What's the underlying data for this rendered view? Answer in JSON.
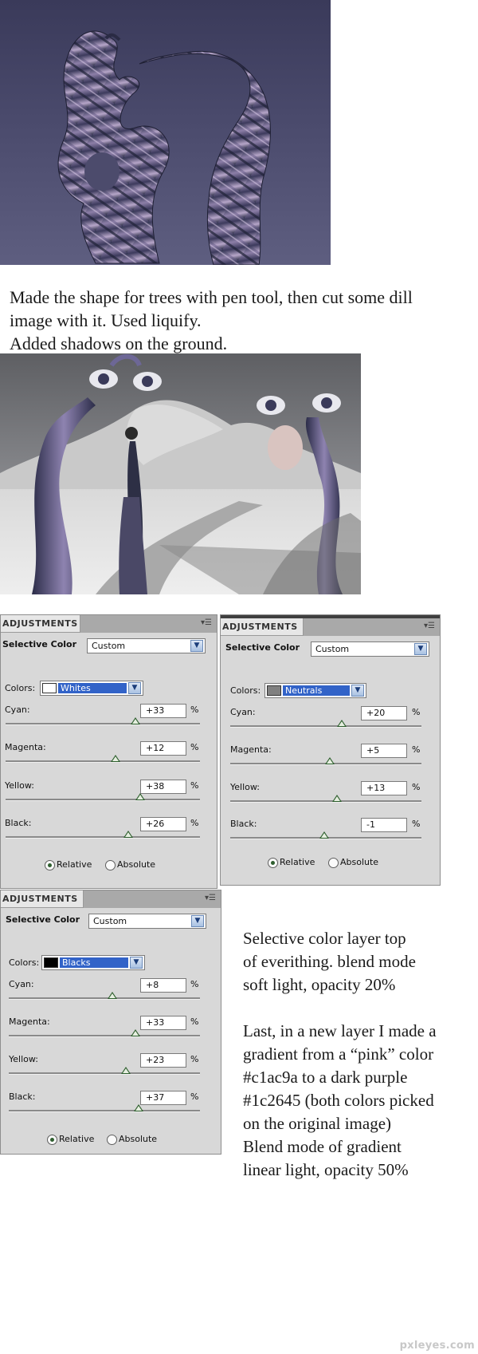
{
  "caption_top": [
    "Made the shape for trees with pen tool, then cut some dill",
    "image with it. Used liquify.",
    "Added shadows on the ground."
  ],
  "panels": [
    {
      "tab": "ADJUSTMENTS",
      "title": "Selective Color",
      "preset": "Custom",
      "colors_label": "Colors:",
      "color": "Whites",
      "swatch_color": "#ffffff",
      "sliders": [
        {
          "label": "Cyan:",
          "value": "+33",
          "pct": "%",
          "level": 33
        },
        {
          "label": "Magenta:",
          "value": "+12",
          "pct": "%",
          "level": 12
        },
        {
          "label": "Yellow:",
          "value": "+38",
          "pct": "%",
          "level": 38
        },
        {
          "label": "Black:",
          "value": "+26",
          "pct": "%",
          "level": 26
        }
      ],
      "relative": "Relative",
      "absolute": "Absolute",
      "mode": "relative"
    },
    {
      "tab": "ADJUSTMENTS",
      "title": "Selective Color",
      "preset": "Custom",
      "colors_label": "Colors:",
      "color": "Neutrals",
      "swatch_color": "#808080",
      "sliders": [
        {
          "label": "Cyan:",
          "value": "+20",
          "pct": "%",
          "level": 20
        },
        {
          "label": "Magenta:",
          "value": "+5",
          "pct": "%",
          "level": 5
        },
        {
          "label": "Yellow:",
          "value": "+13",
          "pct": "%",
          "level": 13
        },
        {
          "label": "Black:",
          "value": "-1",
          "pct": "%",
          "level": -1
        }
      ],
      "relative": "Relative",
      "absolute": "Absolute",
      "mode": "relative"
    },
    {
      "tab": "ADJUSTMENTS",
      "title": "Selective Color",
      "preset": "Custom",
      "colors_label": "Colors:",
      "color": "Blacks",
      "swatch_color": "#000000",
      "sliders": [
        {
          "label": "Cyan:",
          "value": "+8",
          "pct": "%",
          "level": 8
        },
        {
          "label": "Magenta:",
          "value": "+33",
          "pct": "%",
          "level": 33
        },
        {
          "label": "Yellow:",
          "value": "+23",
          "pct": "%",
          "level": 23
        },
        {
          "label": "Black:",
          "value": "+37",
          "pct": "%",
          "level": 37
        }
      ],
      "relative": "Relative",
      "absolute": "Absolute",
      "mode": "relative"
    }
  ],
  "caption_bottom": [
    "Selective color layer top",
    "of everithing. blend mode",
    "soft light, opacity 20%",
    "",
    "Last, in a new layer I made a",
    "gradient from a “pink” color",
    "#c1ac9a to a dark purple",
    "#1c2645 (both colors picked",
    "on the original image)",
    "Blend mode of gradient",
    "linear light, opacity 50%"
  ],
  "watermark": "pxleyes.com",
  "colors": {
    "pink": "#c1ac9a",
    "dark_purple": "#1c2645",
    "panel_bg": "#d8d8d8",
    "highlight": "#3263c8"
  },
  "icons": [
    "panel-menu-icon",
    "dropdown-arrow-icon",
    "slider-thumb-icon",
    "radio-icon"
  ]
}
